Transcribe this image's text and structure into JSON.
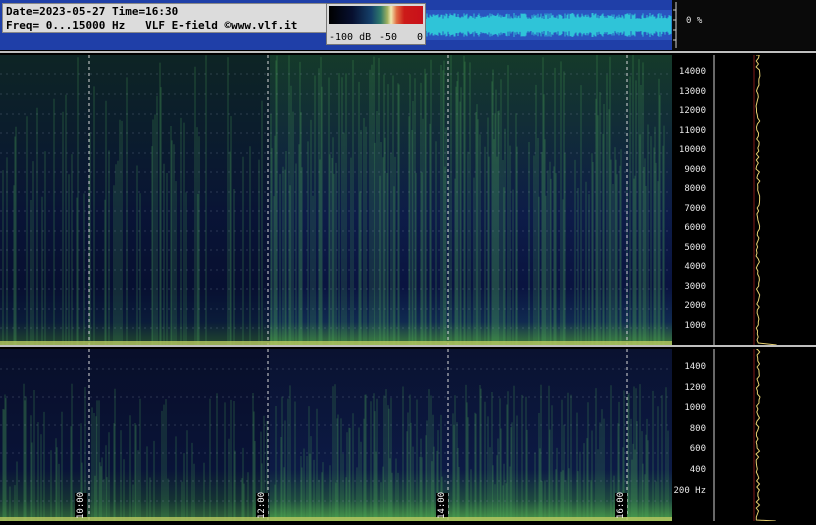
{
  "header": {
    "date_line": "Date=2023-05-27 Time=16:30",
    "freq_line": "Freq= 0...15000 Hz   VLF E-field ©www.vlf.it"
  },
  "colorbar": {
    "label_min": "-100 dB",
    "label_mid": "-50",
    "label_max": "0"
  },
  "top_panel": {
    "percent_label": "0 %"
  },
  "main_axis": {
    "labels": [
      "14000",
      "13000",
      "12000",
      "11000",
      "10000",
      "9000",
      "8000",
      "7000",
      "6000",
      "5000",
      "4000",
      "3000",
      "2000",
      "1000"
    ]
  },
  "low_axis": {
    "labels": [
      "1400",
      "1200",
      "1000",
      "800",
      "600",
      "400",
      "200 Hz"
    ]
  },
  "time_marks": [
    "10:00",
    "12:00",
    "14:00",
    "16:00"
  ],
  "colors": {
    "background": "#000000",
    "top_strip": "#1f3fa8",
    "waveform": "#2fc4d8",
    "spectrum_green": "#3f8f3f",
    "spectrum_blue": "#0c1a4a"
  }
}
